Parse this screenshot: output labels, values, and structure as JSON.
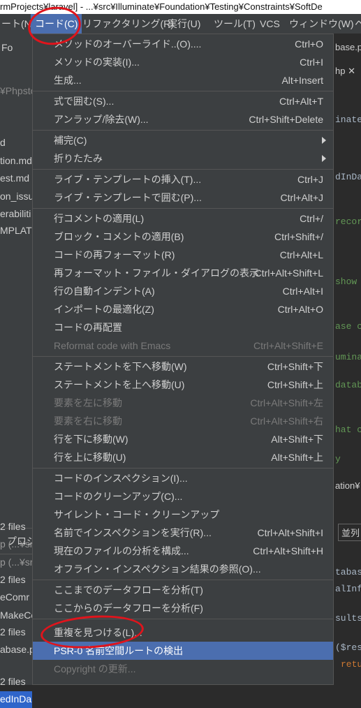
{
  "window": {
    "title": "rmProjects¥laravel] - ...¥src¥Illuminate¥Foundation¥Testing¥Constraints¥SoftDe"
  },
  "menubar": {
    "items": [
      "ート(N)",
      "コード(C)",
      "リファクタリング(R)",
      "実行(U)",
      "ツール(T)",
      "VCS",
      "ウィンドウ(W)",
      "ヘ"
    ]
  },
  "background_left": {
    "lines": [
      "Fo",
      "¥Phpsto",
      "d",
      "tion.md",
      "est.md",
      "on_issu",
      "erabiliti",
      "MPLATE",
      "プロジ",
      "2 files",
      "p (...¥sr",
      "p (...¥sr",
      "2 files",
      "eComr",
      "MakeCo",
      "2 files",
      "abase.p",
      "edInDa",
      "2 files"
    ]
  },
  "background_right": {
    "lines": [
      "base.p",
      "hp ✕",
      "inate",
      "dInDa",
      "recor",
      "show",
      "ase co",
      "umina",
      "datab",
      "hat c",
      "y",
      "ation¥",
      "並列",
      "tabase",
      "alInf",
      "sults",
      "($res",
      "retu"
    ]
  },
  "menu": {
    "items": [
      {
        "label": "メソッドのオーバーライド..(O)....",
        "shortcut": "Ctrl+O"
      },
      {
        "label": "メソッドの実装(I)...",
        "shortcut": "Ctrl+I"
      },
      {
        "label": "生成...",
        "shortcut": "Alt+Insert"
      },
      {
        "label": "式で囲む(S)...",
        "shortcut": "Ctrl+Alt+T"
      },
      {
        "label": "アンラップ/除去(W)...",
        "shortcut": "Ctrl+Shift+Delete"
      },
      {
        "label": "補完(C)",
        "shortcut": ""
      },
      {
        "label": "折りたたみ",
        "shortcut": ""
      },
      {
        "label": "ライブ・テンプレートの挿入(T)...",
        "shortcut": "Ctrl+J"
      },
      {
        "label": "ライブ・テンプレートで囲む(P)...",
        "shortcut": "Ctrl+Alt+J"
      },
      {
        "label": "行コメントの適用(L)",
        "shortcut": "Ctrl+/"
      },
      {
        "label": "ブロック・コメントの適用(B)",
        "shortcut": "Ctrl+Shift+/"
      },
      {
        "label": "コードの再フォーマット(R)",
        "shortcut": "Ctrl+Alt+L"
      },
      {
        "label": "再フォーマット・ファイル・ダイアログの表示",
        "shortcut": "Ctrl+Alt+Shift+L"
      },
      {
        "label": "行の自動インデント(A)",
        "shortcut": "Ctrl+Alt+I"
      },
      {
        "label": "インポートの最適化(Z)",
        "shortcut": "Ctrl+Alt+O"
      },
      {
        "label": "コードの再配置",
        "shortcut": ""
      },
      {
        "label": "Reformat code with Emacs",
        "shortcut": "Ctrl+Alt+Shift+E"
      },
      {
        "label": "ステートメントを下へ移動(W)",
        "shortcut": "Ctrl+Shift+下"
      },
      {
        "label": "ステートメントを上へ移動(U)",
        "shortcut": "Ctrl+Shift+上"
      },
      {
        "label": "要素を左に移動",
        "shortcut": "Ctrl+Alt+Shift+左"
      },
      {
        "label": "要素を右に移動",
        "shortcut": "Ctrl+Alt+Shift+右"
      },
      {
        "label": "行を下に移動(W)",
        "shortcut": "Alt+Shift+下"
      },
      {
        "label": "行を上に移動(U)",
        "shortcut": "Alt+Shift+上"
      },
      {
        "label": "コードのインスペクション(I)...",
        "shortcut": ""
      },
      {
        "label": "コードのクリーンアップ(C)...",
        "shortcut": ""
      },
      {
        "label": "サイレント・コード・クリーンアップ",
        "shortcut": ""
      },
      {
        "label": "名前でインスペクションを実行(R)...",
        "shortcut": "Ctrl+Alt+Shift+I"
      },
      {
        "label": "現在のファイルの分析を構成...",
        "shortcut": "Ctrl+Alt+Shift+H"
      },
      {
        "label": "オフライン・インスペクション結果の参照(O)...",
        "shortcut": ""
      },
      {
        "label": "ここまでのデータフローを分析(T)",
        "shortcut": ""
      },
      {
        "label": "ここからのデータフローを分析(F)",
        "shortcut": ""
      },
      {
        "label": "重複を見つける(L)...",
        "shortcut": ""
      },
      {
        "label": "PSR-0 名前空間ルートの検出",
        "shortcut": ""
      },
      {
        "label": "Copyright の更新...",
        "shortcut": ""
      }
    ]
  },
  "colors": {
    "menu_bg": "#3c3f41",
    "highlight": "#4b6eaf",
    "disabled_text": "#7a7a7a",
    "annotation_red": "#e0141c"
  }
}
